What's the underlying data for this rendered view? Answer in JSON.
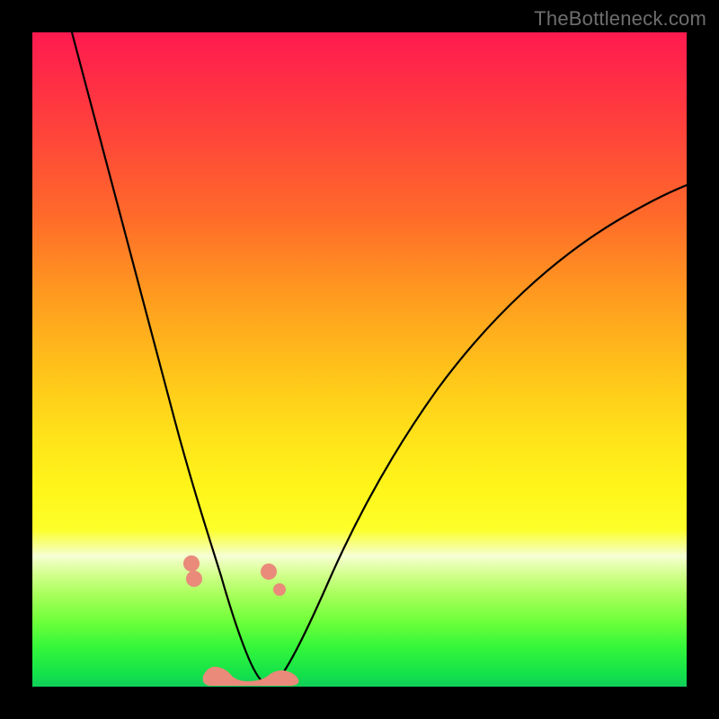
{
  "watermark": "TheBottleneck.com",
  "colors": {
    "salmon": "#e98a7a",
    "curve": "#000000",
    "gradient_top": "#ff1a4f",
    "gradient_bottom": "#10d05a"
  },
  "chart_data": {
    "type": "line",
    "title": "",
    "xlabel": "",
    "ylabel": "",
    "xlim": [
      0,
      100
    ],
    "ylim": [
      0,
      100
    ],
    "grid": false,
    "legend": false,
    "series": [
      {
        "name": "bottleneck-curve",
        "x": [
          6,
          8,
          10,
          12,
          14,
          16,
          18,
          20,
          22,
          24,
          26,
          27,
          28,
          29,
          30,
          31,
          32,
          34,
          36,
          38,
          40,
          44,
          48,
          52,
          56,
          60,
          66,
          72,
          80,
          88,
          96,
          100
        ],
        "values": [
          100,
          91,
          82,
          73,
          64,
          55,
          47,
          39,
          32,
          25,
          18,
          14,
          10,
          6,
          3,
          1,
          0.5,
          1,
          4,
          8,
          12,
          20,
          27,
          33,
          38,
          43,
          49,
          54,
          60,
          65,
          69,
          71
        ]
      }
    ],
    "markers": [
      {
        "name": "left-upper-dot",
        "x": 24.2,
        "y": 18.0,
        "r": 1.2
      },
      {
        "name": "left-lower-dot",
        "x": 24.5,
        "y": 16.0,
        "r": 1.2
      },
      {
        "name": "right-upper-dot",
        "x": 36.0,
        "y": 17.0,
        "r": 1.2
      },
      {
        "name": "right-mid-dot",
        "x": 37.5,
        "y": 14.5,
        "r": 0.9
      },
      {
        "name": "floor-blob",
        "x": 30.0,
        "y": 2.0,
        "w": 9.0,
        "h": 3.0
      }
    ]
  }
}
